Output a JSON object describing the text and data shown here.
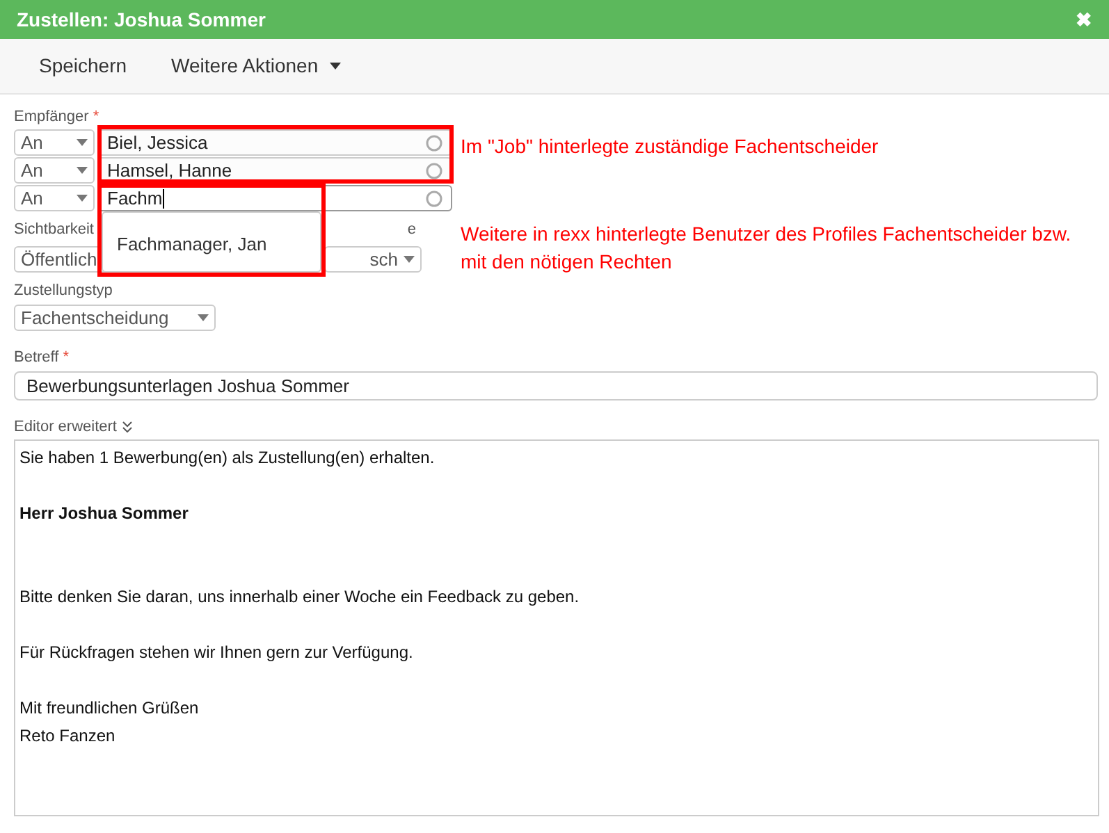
{
  "window": {
    "title": "Zustellen: Joshua Sommer",
    "close": "✖"
  },
  "toolbar": [
    {
      "label": "Speichern",
      "kind": "button"
    },
    {
      "label": "Weitere Aktionen",
      "kind": "menu"
    }
  ],
  "recipients": {
    "label": "Empfänger",
    "required_mark": "*",
    "rows": [
      {
        "type": "An",
        "value": "Biel, Jessica",
        "focused": false
      },
      {
        "type": "An",
        "value": "Hamsel, Hanne",
        "focused": false
      },
      {
        "type": "An",
        "value": "Fachm",
        "focused": true
      }
    ],
    "suggestions": [
      "Fachmanager, Jan"
    ]
  },
  "visibility": {
    "label": "Sichtbarkeit",
    "value": "Öffentlich",
    "label_2": "e",
    "value_2": "sch"
  },
  "delivery_type": {
    "label": "Zustellungstyp",
    "value": "Fachentscheidung"
  },
  "subject": {
    "label": "Betreff",
    "required_mark": "*",
    "value": "Bewerbungsunterlagen Joshua Sommer"
  },
  "editor": {
    "label": "Editor erweitert",
    "lines": [
      {
        "text": "Sie haben 1 Bewerbung(en) als Zustellung(en) erhalten.",
        "bold": false
      },
      {
        "text": "Herr Joshua Sommer",
        "bold": true
      },
      {
        "text": "Bitte denken Sie daran, uns innerhalb einer Woche ein Feedback zu geben.",
        "bold": false
      },
      {
        "text": "Für Rückfragen stehen wir Ihnen gern zur Verfügung.",
        "bold": false
      },
      {
        "text": "Mit freundlichen Grüßen",
        "bold": false
      },
      {
        "text": "Reto Fanzen",
        "bold": false
      }
    ]
  },
  "annotations": [
    "Im \"Job\" hinterlegte zuständige Fachentscheider",
    "Weitere in rexx hinterlegte Benutzer des Profiles Fachentscheider bzw. mit den nötigen Rechten"
  ]
}
